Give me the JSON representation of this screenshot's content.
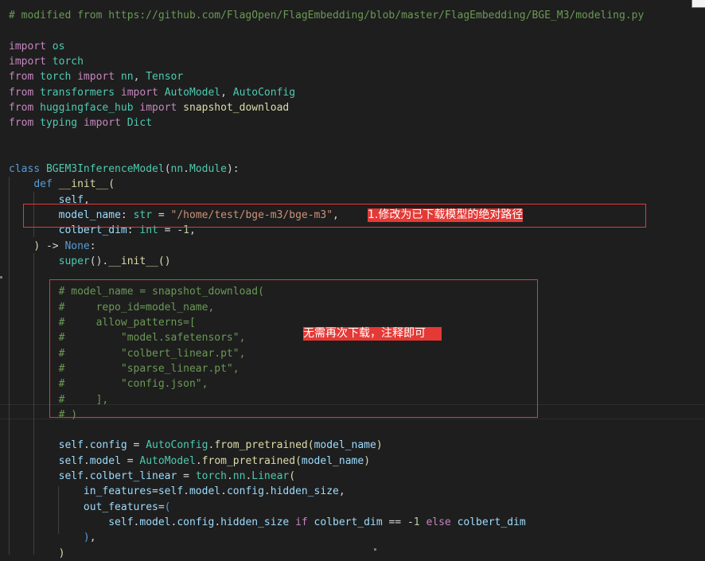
{
  "colors": {
    "background": "#1e1e1e",
    "default": "#d4d4d4",
    "comment": "#6a9955",
    "keyword": "#569cd6",
    "control": "#c586c0",
    "function": "#dcdcaa",
    "type": "#4ec9b0",
    "variable": "#9cdcfe",
    "string": "#ce9178",
    "number": "#b5cea8",
    "annotation": "#e53935"
  },
  "code_lines": [
    [
      [
        "# modified from https://github.com/FlagOpen/FlagEmbedding/blob/master/FlagEmbedding/BGE_M3/modeling.py",
        "comment"
      ]
    ],
    [
      [
        "",
        "default"
      ]
    ],
    [
      [
        "import",
        "control"
      ],
      [
        " ",
        "default"
      ],
      [
        "os",
        "type"
      ]
    ],
    [
      [
        "import",
        "control"
      ],
      [
        " ",
        "default"
      ],
      [
        "torch",
        "type"
      ]
    ],
    [
      [
        "from",
        "control"
      ],
      [
        " ",
        "default"
      ],
      [
        "torch",
        "type"
      ],
      [
        " ",
        "default"
      ],
      [
        "import",
        "control"
      ],
      [
        " ",
        "default"
      ],
      [
        "nn",
        "type"
      ],
      [
        ", ",
        "default"
      ],
      [
        "Tensor",
        "type"
      ]
    ],
    [
      [
        "from",
        "control"
      ],
      [
        " ",
        "default"
      ],
      [
        "transformers",
        "type"
      ],
      [
        " ",
        "default"
      ],
      [
        "import",
        "control"
      ],
      [
        " ",
        "default"
      ],
      [
        "AutoModel",
        "type"
      ],
      [
        ", ",
        "default"
      ],
      [
        "AutoConfig",
        "type"
      ]
    ],
    [
      [
        "from",
        "control"
      ],
      [
        " ",
        "default"
      ],
      [
        "huggingface_hub",
        "type"
      ],
      [
        " ",
        "default"
      ],
      [
        "import",
        "control"
      ],
      [
        " ",
        "default"
      ],
      [
        "snapshot_download",
        "function"
      ]
    ],
    [
      [
        "from",
        "control"
      ],
      [
        " ",
        "default"
      ],
      [
        "typing",
        "type"
      ],
      [
        " ",
        "default"
      ],
      [
        "import",
        "control"
      ],
      [
        " ",
        "default"
      ],
      [
        "Dict",
        "type"
      ]
    ],
    [
      [
        "",
        "default"
      ]
    ],
    [
      [
        "",
        "default"
      ]
    ],
    [
      [
        "class",
        "keyword"
      ],
      [
        " ",
        "default"
      ],
      [
        "BGEM3InferenceModel",
        "type"
      ],
      [
        "(",
        "default"
      ],
      [
        "nn",
        "type"
      ],
      [
        ".",
        "default"
      ],
      [
        "Module",
        "type"
      ],
      [
        "):",
        "default"
      ]
    ],
    [
      [
        "    ",
        "default"
      ],
      [
        "def",
        "keyword"
      ],
      [
        " ",
        "default"
      ],
      [
        "__init__",
        "function"
      ],
      [
        "(",
        "function"
      ]
    ],
    [
      [
        "        ",
        "default"
      ],
      [
        "self",
        "variable"
      ],
      [
        ",",
        "default"
      ]
    ],
    [
      [
        "        ",
        "default"
      ],
      [
        "model_name",
        "variable"
      ],
      [
        ": ",
        "default"
      ],
      [
        "str",
        "type"
      ],
      [
        " = ",
        "default"
      ],
      [
        "\"/home/test/bge-m3/bge-m3\"",
        "string"
      ],
      [
        ",",
        "default"
      ]
    ],
    [
      [
        "        ",
        "default"
      ],
      [
        "colbert_dim",
        "variable"
      ],
      [
        ": ",
        "default"
      ],
      [
        "int",
        "type"
      ],
      [
        " = -",
        "default"
      ],
      [
        "1",
        "number"
      ],
      [
        ",",
        "default"
      ]
    ],
    [
      [
        "    ",
        "default"
      ],
      [
        ")",
        "function"
      ],
      [
        " -> ",
        "default"
      ],
      [
        "None",
        "keyword"
      ],
      [
        ":",
        "default"
      ]
    ],
    [
      [
        "        ",
        "default"
      ],
      [
        "super",
        "type"
      ],
      [
        "().",
        "default"
      ],
      [
        "__init__",
        "function"
      ],
      [
        "()",
        "function"
      ]
    ],
    [
      [
        "",
        "default"
      ]
    ],
    [
      [
        "        # model_name = snapshot_download(",
        "comment"
      ]
    ],
    [
      [
        "        #     repo_id=model_name,",
        "comment"
      ]
    ],
    [
      [
        "        #     allow_patterns=[",
        "comment"
      ]
    ],
    [
      [
        "        #         \"model.safetensors\",",
        "comment"
      ]
    ],
    [
      [
        "        #         \"colbert_linear.pt\",",
        "comment"
      ]
    ],
    [
      [
        "        #         \"sparse_linear.pt\",",
        "comment"
      ]
    ],
    [
      [
        "        #         \"config.json\",",
        "comment"
      ]
    ],
    [
      [
        "        #     ],",
        "comment"
      ]
    ],
    [
      [
        "        # )",
        "comment"
      ]
    ],
    [
      [
        "",
        "default"
      ]
    ],
    [
      [
        "        ",
        "default"
      ],
      [
        "self",
        "variable"
      ],
      [
        ".",
        "default"
      ],
      [
        "config",
        "variable"
      ],
      [
        " = ",
        "default"
      ],
      [
        "AutoConfig",
        "type"
      ],
      [
        ".",
        "default"
      ],
      [
        "from_pretrained",
        "function"
      ],
      [
        "(",
        "function"
      ],
      [
        "model_name",
        "variable"
      ],
      [
        ")",
        "function"
      ]
    ],
    [
      [
        "        ",
        "default"
      ],
      [
        "self",
        "variable"
      ],
      [
        ".",
        "default"
      ],
      [
        "model",
        "variable"
      ],
      [
        " = ",
        "default"
      ],
      [
        "AutoModel",
        "type"
      ],
      [
        ".",
        "default"
      ],
      [
        "from_pretrained",
        "function"
      ],
      [
        "(",
        "function"
      ],
      [
        "model_name",
        "variable"
      ],
      [
        ")",
        "function"
      ]
    ],
    [
      [
        "        ",
        "default"
      ],
      [
        "self",
        "variable"
      ],
      [
        ".",
        "default"
      ],
      [
        "colbert_linear",
        "variable"
      ],
      [
        " = ",
        "default"
      ],
      [
        "torch",
        "type"
      ],
      [
        ".",
        "default"
      ],
      [
        "nn",
        "type"
      ],
      [
        ".",
        "default"
      ],
      [
        "Linear",
        "type"
      ],
      [
        "(",
        "function"
      ]
    ],
    [
      [
        "            ",
        "default"
      ],
      [
        "in_features",
        "variable"
      ],
      [
        "=",
        "default"
      ],
      [
        "self",
        "variable"
      ],
      [
        ".",
        "default"
      ],
      [
        "model",
        "variable"
      ],
      [
        ".",
        "default"
      ],
      [
        "config",
        "variable"
      ],
      [
        ".",
        "default"
      ],
      [
        "hidden_size",
        "variable"
      ],
      [
        ",",
        "default"
      ]
    ],
    [
      [
        "            ",
        "default"
      ],
      [
        "out_features",
        "variable"
      ],
      [
        "=",
        "default"
      ],
      [
        "(",
        "keyword"
      ]
    ],
    [
      [
        "                ",
        "default"
      ],
      [
        "self",
        "variable"
      ],
      [
        ".",
        "default"
      ],
      [
        "model",
        "variable"
      ],
      [
        ".",
        "default"
      ],
      [
        "config",
        "variable"
      ],
      [
        ".",
        "default"
      ],
      [
        "hidden_size",
        "variable"
      ],
      [
        " ",
        "default"
      ],
      [
        "if",
        "control"
      ],
      [
        " ",
        "default"
      ],
      [
        "colbert_dim",
        "variable"
      ],
      [
        " == -",
        "default"
      ],
      [
        "1",
        "number"
      ],
      [
        " ",
        "default"
      ],
      [
        "else",
        "control"
      ],
      [
        " ",
        "default"
      ],
      [
        "colbert_dim",
        "variable"
      ]
    ],
    [
      [
        "            ",
        "default"
      ],
      [
        ")",
        "keyword"
      ],
      [
        ",",
        "default"
      ]
    ],
    [
      [
        "        ",
        "default"
      ],
      [
        ")",
        "function"
      ]
    ]
  ],
  "annotations": {
    "note_1": "1.修改为已下载模型的绝对路径",
    "note_2": "无需再次下载，注释即可"
  }
}
